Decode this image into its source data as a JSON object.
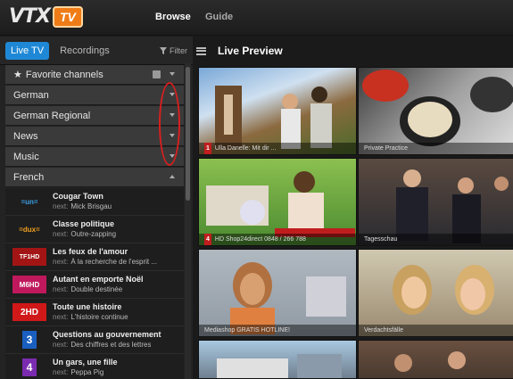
{
  "app": {
    "logo_text": "VTX",
    "logo_badge": "TV"
  },
  "nav": {
    "browse": "Browse",
    "guide": "Guide"
  },
  "left_tabs": {
    "live": "Live TV",
    "recordings": "Recordings",
    "filter": "Filter"
  },
  "categories": {
    "favorites": "Favorite channels",
    "german": "German",
    "german_regional": "German Regional",
    "news": "News",
    "music": "Music",
    "french": "French"
  },
  "channels": [
    {
      "logo": "=un=",
      "logo_color": "#3aa0e8",
      "title": "Cougar Town",
      "next_label": "next:",
      "next": "Mick Brisgau"
    },
    {
      "logo": "=dux=",
      "logo_color": "#f0a020",
      "title": "Classe politique",
      "next_label": "next:",
      "next": "Outre-zapping"
    },
    {
      "logo": "TF1HD",
      "logo_color": "#ffffff",
      "title": "Les feux de l'amour",
      "next_label": "next:",
      "next": "À la recherche de l'esprit ..."
    },
    {
      "logo": "M6HD",
      "logo_color": "#ffffff",
      "title": "Autant en emporte Noël",
      "next_label": "next:",
      "next": "Double destinée"
    },
    {
      "logo": "2HD",
      "logo_color": "#ffffff",
      "title": "Toute une histoire",
      "next_label": "next:",
      "next": "L'histoire continue"
    },
    {
      "logo": "3",
      "logo_color": "#ffffff",
      "title": "Questions au gouvernement",
      "next_label": "next:",
      "next": "Des chiffres et des lettres"
    },
    {
      "logo": "4",
      "logo_color": "#ffffff",
      "title": "Un gars, une fille",
      "next_label": "next:",
      "next": "Peppa Pig"
    }
  ],
  "preview": {
    "title": "Live Preview",
    "tiles": [
      {
        "num": "1",
        "caption": "Ulla Danelle: Mit dir ..."
      },
      {
        "num": "",
        "caption": "Private Practice"
      },
      {
        "num": "4",
        "caption": "HD Shop24direct  0848 / 266 788"
      },
      {
        "num": "",
        "caption": "Tagesschau"
      },
      {
        "num": "",
        "caption": "Mediashop  GRATIS HOTLINE!"
      },
      {
        "num": "",
        "caption": "Verdachtsfälle"
      },
      {
        "num": "",
        "caption": ""
      },
      {
        "num": "",
        "caption": ""
      }
    ]
  },
  "colors": {
    "accent": "#1f88d6",
    "badge": "#f07c17",
    "annotation": "#d81f1f"
  }
}
